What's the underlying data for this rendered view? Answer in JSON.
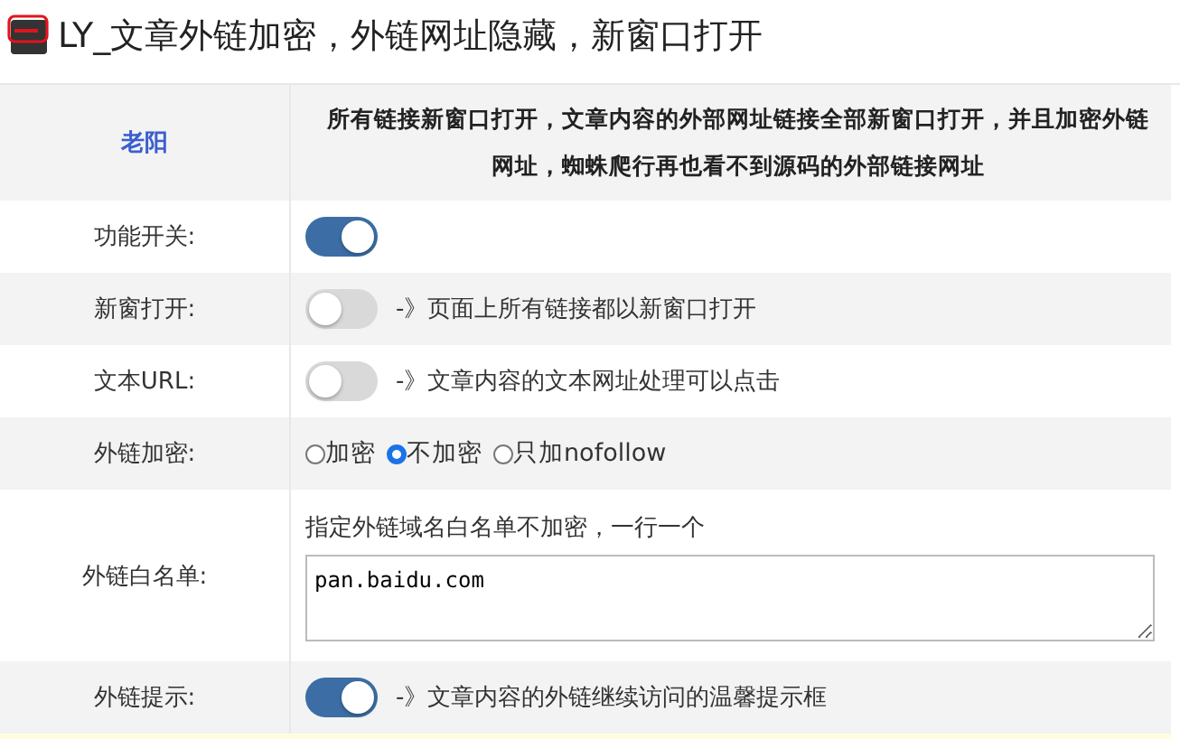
{
  "page_title": "LY_文章外链加密，外链网址隐藏，新窗口打开",
  "header": {
    "author": "老阳",
    "description": "所有链接新窗口打开，文章内容的外部网址链接全部新窗口打开，并且加密外链网址，蜘蛛爬行再也看不到源码的外部链接网址"
  },
  "rows": [
    {
      "kind": "toggle",
      "label": "功能开关:",
      "on": true
    },
    {
      "kind": "toggle",
      "label": "新窗打开:",
      "on": false,
      "hint": "-》页面上所有链接都以新窗口打开"
    },
    {
      "kind": "toggle",
      "label": "文本URL:",
      "on": false,
      "hint": "-》文章内容的文本网址处理可以点击"
    },
    {
      "kind": "radio",
      "label": "外链加密:",
      "options": [
        {
          "label": "加密",
          "selected": false
        },
        {
          "label": "不加密",
          "selected": true
        },
        {
          "label": "只加nofollow",
          "selected": false
        }
      ]
    },
    {
      "kind": "textarea",
      "label": "外链白名单:",
      "hint": "指定外链域名白名单不加密，一行一个",
      "value": "pan.baidu.com"
    },
    {
      "kind": "toggle",
      "label": "外链提示:",
      "on": true,
      "hint": "-》文章内容的外链继续访问的温馨提示框"
    }
  ]
}
